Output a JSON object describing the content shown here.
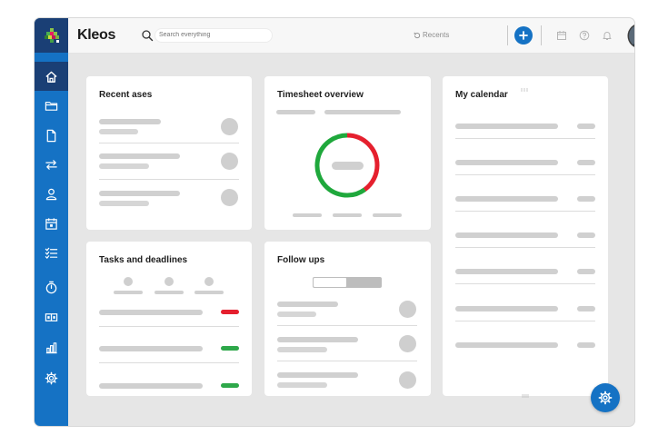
{
  "app": {
    "title": "Kleos",
    "brand_color": "#1572c4",
    "brand_dark": "#1a3f75"
  },
  "search": {
    "placeholder": "Search everything"
  },
  "topbar": {
    "recents_label": "Recents",
    "icons": [
      "calendar-icon",
      "help-icon",
      "bell-icon"
    ]
  },
  "sidebar": {
    "items": [
      {
        "icon": "home-icon",
        "active": true
      },
      {
        "icon": "folder-icon"
      },
      {
        "icon": "document-icon"
      },
      {
        "icon": "transfer-icon"
      },
      {
        "icon": "person-icon"
      },
      {
        "icon": "calendar-icon"
      },
      {
        "icon": "checklist-icon"
      },
      {
        "icon": "timer-icon"
      },
      {
        "icon": "cards-icon"
      },
      {
        "icon": "bar-chart-icon"
      },
      {
        "icon": "settings-icon"
      }
    ]
  },
  "cards": {
    "recent_cases": {
      "title": "Recent ases"
    },
    "timesheet": {
      "title": "Timesheet overview",
      "donut": {
        "green_fraction": 0.6,
        "red_fraction": 0.4,
        "green": "#1fa83c",
        "red": "#e5202e"
      }
    },
    "calendar": {
      "title": "My calendar"
    },
    "tasks": {
      "title": "Tasks and deadlines",
      "status_colors": [
        "#e5202e",
        "#2ea84a",
        "#2ea84a"
      ]
    },
    "followups": {
      "title": "Follow ups"
    }
  }
}
